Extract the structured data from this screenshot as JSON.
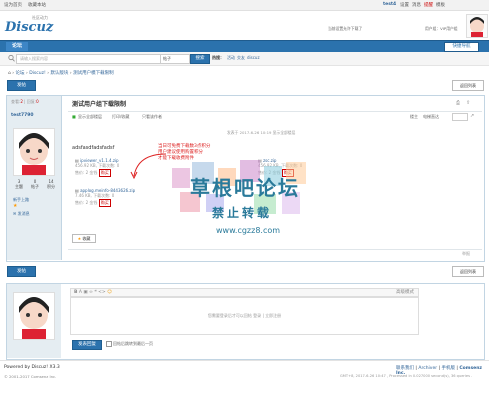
{
  "topbar": {
    "left": [
      "设为首页",
      "收藏本站"
    ],
    "user": "test4",
    "links": [
      "设置",
      "消息",
      "提醒",
      "模板"
    ],
    "ad": "当前设置允许下载了",
    "links2": "用户组：VIP用户组"
  },
  "nav": {
    "home": "论坛",
    "quick": "快捷导航"
  },
  "search": {
    "placeholder": "请输入搜索内容",
    "type": "帖子",
    "button": "搜索",
    "hot_label": "热搜：",
    "hot": [
      "活动",
      "交友",
      "discuz"
    ]
  },
  "breadcrumb": [
    "论坛",
    "Discuz!",
    "默认版块",
    "测试用户模下载限制"
  ],
  "actions": {
    "post": "发帖",
    "back": "返回列表",
    "reply": "回复"
  },
  "thread": {
    "views_label": "查看:",
    "views": "2",
    "replies_label": "回复:",
    "replies": "0",
    "title": "测试用户组下载限制",
    "tabs": [
      "只看该作者",
      "楼主",
      "电梯直达"
    ],
    "toolbar": [
      "显示全部楼层",
      "打印/收藏"
    ],
    "posted": "发表于 2017-6-26 10:19 显示全部楼层",
    "body": "adsfasdfadsfadsf",
    "attach_tip": "下载附件",
    "attachments": [
      {
        "name": "aaa.zip",
        "meta": "88.17 KB, 下载次数: 1",
        "price": "下载积分: 威望 -1 点",
        "btn": "购买"
      },
      {
        "name": "ipviewer_v1.1.4.zip",
        "meta": "456.92 KB, 下载次数: 0",
        "price": "售价: 2 金钱",
        "btn": "购买"
      },
      {
        "name": "zsc.zip",
        "meta": "456.92 KB, 下载次数: 0",
        "price": "售价: 2 金钱",
        "btn": "购买"
      },
      {
        "name": "applog.meinfo-8443626.zip",
        "meta": "7.46 KB, 下载次数: 0",
        "price": "售价: 2 金钱",
        "btn": "购买"
      }
    ],
    "note": [
      "当日可免费下载数3点积分",
      "用户建议使用购置积分",
      "才能下载收费附件"
    ],
    "fav": "收藏",
    "report": "举报"
  },
  "profile": {
    "name": "test7790",
    "stats": [
      {
        "v": "3",
        "l": "主题"
      },
      {
        "v": "0",
        "l": "帖子"
      },
      {
        "v": "14",
        "l": "积分"
      }
    ],
    "rank": "新手上路",
    "send": "发消息"
  },
  "watermark": {
    "title": "草根吧论坛",
    "sub": "禁止转载",
    "url": "www.cgzz8.com"
  },
  "editor": {
    "mode": "高级模式",
    "placeholder": "您需要登录后才可以回帖 登录 | 立即注册",
    "submit": "发表回复",
    "notify": "回帖后跳转到最后一页"
  },
  "footer": {
    "powered": "Powered by Discuz! X3.3",
    "copyright": "© 2001-2017 Comsenz Inc.",
    "links": [
      "联系我们",
      "Archiver",
      "手机版",
      "Comsenz Inc."
    ],
    "time": "GMT+8, 2017-6-26 10:47 , Processed in 0.027000 second(s), 36 queries ."
  }
}
